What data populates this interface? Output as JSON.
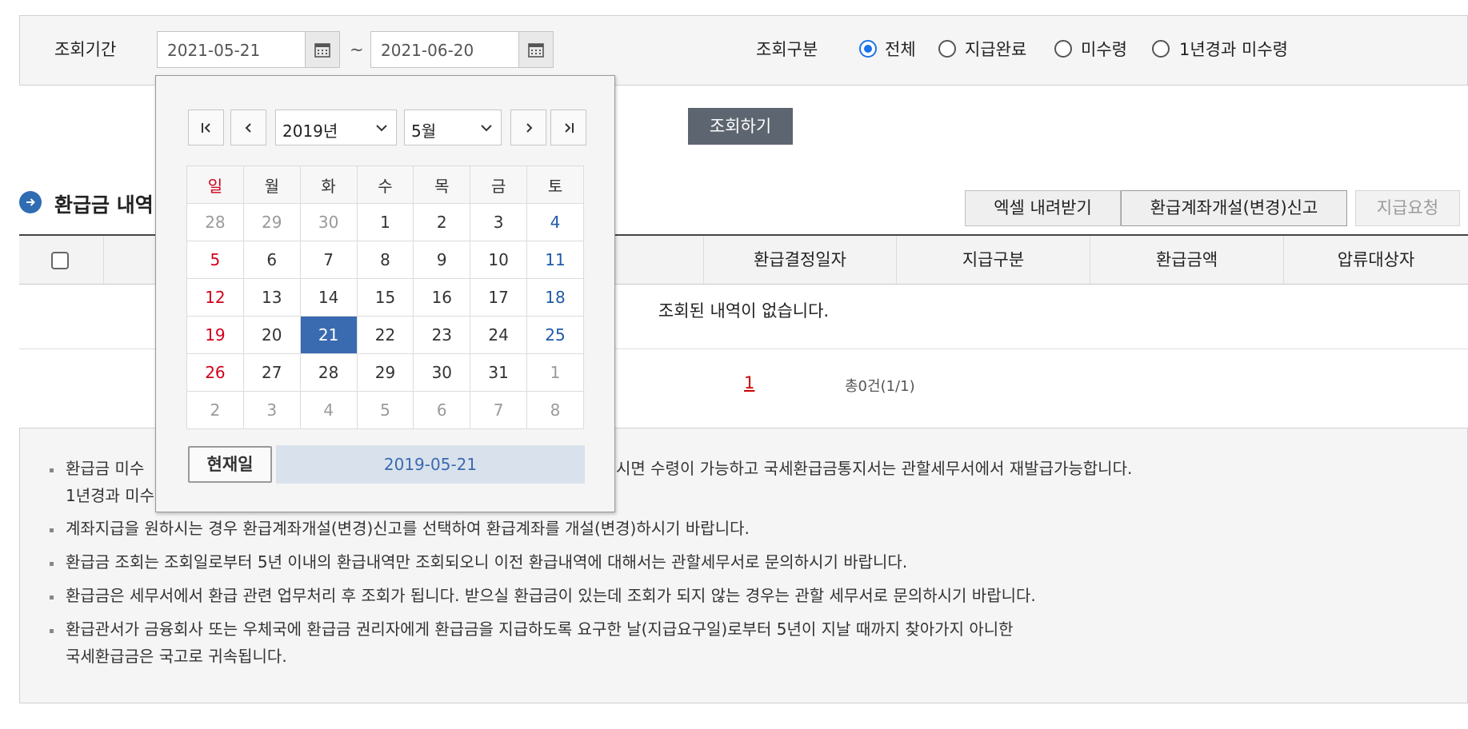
{
  "search": {
    "period_label": "조회기간",
    "start_date": "2021-05-21",
    "end_date": "2021-06-20",
    "tilde": "~",
    "type_label": "조회구분",
    "options": [
      "전체",
      "지급완료",
      "미수령",
      "1년경과 미수령"
    ],
    "selected_option": "전체",
    "submit_label": "조회하기"
  },
  "section": {
    "title": "환급금 내역",
    "buttons": {
      "excel": "엑셀 내려받기",
      "account": "환급계좌개설(변경)신고",
      "request": "지급요청"
    }
  },
  "table": {
    "visible_headers": [
      "",
      "환급결정일자",
      "지급구분",
      "환급금액",
      "압류대상자"
    ],
    "empty_message": "조회된 내역이 없습니다.",
    "pagination": {
      "current": "1",
      "total": "총0건(1/1)"
    }
  },
  "notes": {
    "n1_part1": "환급금 미수",
    "n1_part2": "시면 수령이 가능하고 국세환급금통지서는 관할세무서에서 재발급가능합니다.",
    "n1_line2": "1년경과 미수",
    "n2": "계좌지급을 원하시는 경우 환급계좌개설(변경)신고를 선택하여 환급계좌를 개설(변경)하시기 바랍니다.",
    "n3": "환급금 조회는 조회일로부터 5년 이내의 환급내역만 조회되오니 이전 환급내역에 대해서는 관할세무서로 문의하시기 바랍니다.",
    "n4": "환급금은 세무서에서 환급 관련 업무처리 후 조회가 됩니다. 받으실 환급금이 있는데 조회가 되지 않는 경우는 관할 세무서로 문의하시기 바랍니다.",
    "n5_line1": "환급관서가 금융회사 또는 우체국에 환급금 권리자에게 환급금을 지급하도록 요구한 날(지급요구일)로부터 5년이 지날 때까지 찾아가지 아니한",
    "n5_line2": "국세환급금은 국고로 귀속됩니다."
  },
  "datepicker": {
    "year": "2019년",
    "month": "5월",
    "weekdays": [
      "일",
      "월",
      "화",
      "수",
      "목",
      "금",
      "토"
    ],
    "weeks": [
      [
        "28",
        "29",
        "30",
        "1",
        "2",
        "3",
        "4"
      ],
      [
        "5",
        "6",
        "7",
        "8",
        "9",
        "10",
        "11"
      ],
      [
        "12",
        "13",
        "14",
        "15",
        "16",
        "17",
        "18"
      ],
      [
        "19",
        "20",
        "21",
        "22",
        "23",
        "24",
        "25"
      ],
      [
        "26",
        "27",
        "28",
        "29",
        "30",
        "31",
        "1"
      ],
      [
        "2",
        "3",
        "4",
        "5",
        "6",
        "7",
        "8"
      ]
    ],
    "selected_day": "21",
    "today_label": "현재일",
    "selected_date": "2019-05-21"
  },
  "colors": {
    "accent": "#3a6ab0",
    "sunday": "#d0021b",
    "saturday": "#1e5aa8",
    "page_current": "#cc0000"
  }
}
